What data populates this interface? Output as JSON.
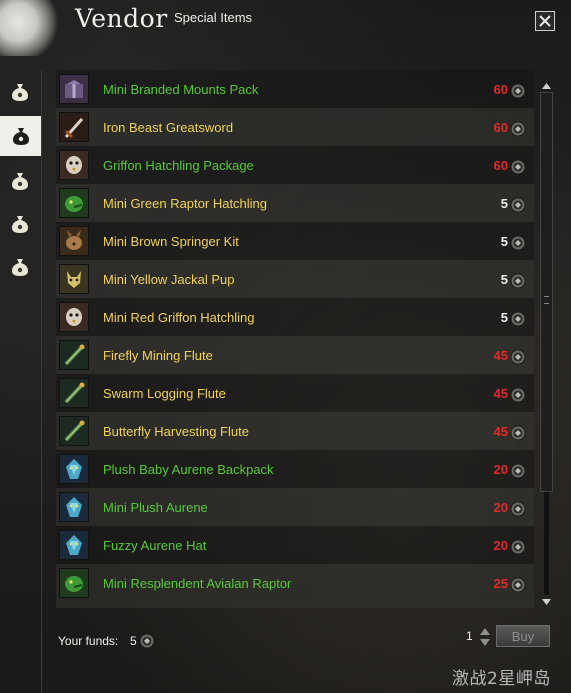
{
  "window": {
    "title": "Vendor",
    "subtitle": "Special Items",
    "close_icon": "close-icon"
  },
  "tabs": [
    {
      "icon": "bag-icon",
      "active": false
    },
    {
      "icon": "bag-icon",
      "active": true
    },
    {
      "icon": "bag-icon",
      "active": false
    },
    {
      "icon": "bag-icon",
      "active": false
    },
    {
      "icon": "bag-icon",
      "active": false
    }
  ],
  "colors": {
    "text_green": "#58c83a",
    "text_yellow": "#f0d35a",
    "price_red": "#e02a2a",
    "price_white": "#f0efe9"
  },
  "items": [
    {
      "name": "Mini Branded Mounts Pack",
      "price": "60",
      "name_color": "green",
      "price_color": "red",
      "icon": "gift-box-icon"
    },
    {
      "name": "Iron Beast Greatsword",
      "price": "60",
      "name_color": "yellow",
      "price_color": "red",
      "icon": "greatsword-icon"
    },
    {
      "name": "Griffon Hatchling Package",
      "price": "60",
      "name_color": "green",
      "price_color": "red",
      "icon": "griffon-icon"
    },
    {
      "name": "Mini Green Raptor Hatchling",
      "price": "5",
      "name_color": "yellow",
      "price_color": "white",
      "icon": "raptor-icon"
    },
    {
      "name": "Mini Brown Springer Kit",
      "price": "5",
      "name_color": "yellow",
      "price_color": "white",
      "icon": "springer-icon"
    },
    {
      "name": "Mini Yellow Jackal Pup",
      "price": "5",
      "name_color": "yellow",
      "price_color": "white",
      "icon": "jackal-icon"
    },
    {
      "name": "Mini Red Griffon Hatchling",
      "price": "5",
      "name_color": "yellow",
      "price_color": "white",
      "icon": "griffon-icon"
    },
    {
      "name": "Firefly Mining Flute",
      "price": "45",
      "name_color": "yellow",
      "price_color": "red",
      "icon": "flute-icon"
    },
    {
      "name": "Swarm Logging Flute",
      "price": "45",
      "name_color": "yellow",
      "price_color": "red",
      "icon": "flute-icon"
    },
    {
      "name": "Butterfly Harvesting Flute",
      "price": "45",
      "name_color": "yellow",
      "price_color": "red",
      "icon": "flute-icon"
    },
    {
      "name": "Plush Baby Aurene Backpack",
      "price": "20",
      "name_color": "green",
      "price_color": "red",
      "icon": "aurene-icon"
    },
    {
      "name": "Mini Plush Aurene",
      "price": "20",
      "name_color": "green",
      "price_color": "red",
      "icon": "aurene-icon"
    },
    {
      "name": "Fuzzy Aurene Hat",
      "price": "20",
      "name_color": "green",
      "price_color": "red",
      "icon": "aurene-icon"
    },
    {
      "name": "Mini Resplendent Avialan Raptor",
      "price": "25",
      "name_color": "green",
      "price_color": "red",
      "icon": "raptor-icon"
    }
  ],
  "footer": {
    "funds_label": "Your funds:",
    "funds_value": "5",
    "quantity": "1",
    "buy_label": "Buy"
  },
  "watermark": "激战2星岬岛"
}
